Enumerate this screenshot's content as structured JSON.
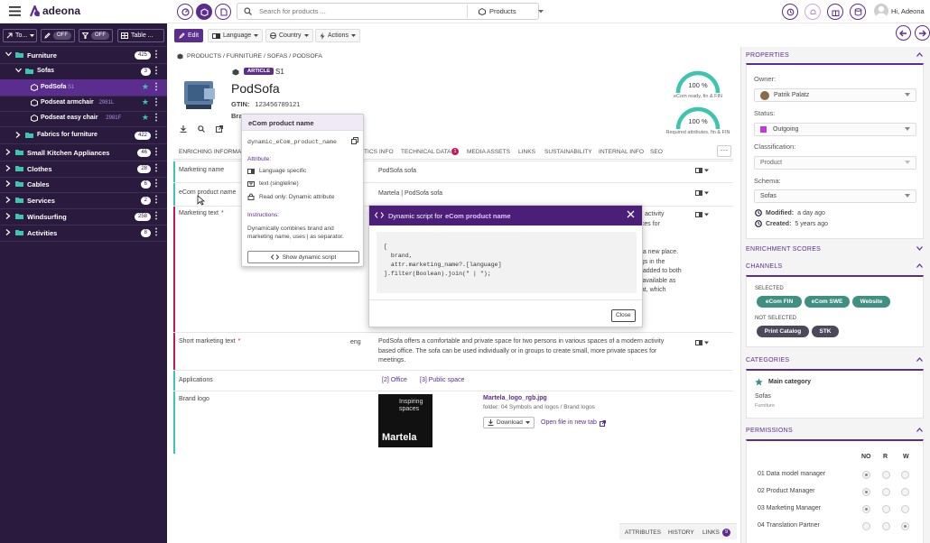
{
  "app": {
    "name": "adeona",
    "user_greeting": "Hi, Adeona"
  },
  "search": {
    "placeholder": "Search for products ...",
    "scope": "Products"
  },
  "sidebar_tools": {
    "type_label": "To...",
    "filter1": "OFF",
    "filter2": "OFF",
    "view_label": "Table ..."
  },
  "tree": [
    {
      "label": "Furniture",
      "count": "425",
      "level": 0
    },
    {
      "label": "Sofas",
      "count": "3",
      "level": 1
    },
    {
      "label": "PodSofa",
      "sku": "S1",
      "level": 2,
      "product": true,
      "selected": true
    },
    {
      "label": "Podseat armchair",
      "sku": "2981L",
      "level": 2,
      "product": true
    },
    {
      "label": "Podseat easy chair",
      "sku": "2981F",
      "level": 2,
      "product": true
    },
    {
      "label": "Fabrics for furniture",
      "count": "422",
      "level": 1
    },
    {
      "label": "Small Kitchen Appliances",
      "count": "46",
      "level": 0
    },
    {
      "label": "Clothes",
      "count": "28",
      "level": 0
    },
    {
      "label": "Cables",
      "count": "6",
      "level": 0
    },
    {
      "label": "Services",
      "count": "2",
      "level": 0
    },
    {
      "label": "Windsurfing",
      "count": "258",
      "level": 0
    },
    {
      "label": "Activities",
      "count": "8",
      "level": 0
    }
  ],
  "actions": {
    "edit": "Edit",
    "language": "Language",
    "country": "Country",
    "actions": "Actions"
  },
  "breadcrumb": "PRODUCTS / FURNITURE / SOFAS / PODSOFA",
  "product": {
    "badge": "ARTICLE",
    "sku": "S1",
    "name": "PodSofa",
    "gtin_label": "GTIN:",
    "gtin": "123456789121",
    "brand_label": "Bra"
  },
  "scores": [
    {
      "value": "100 %",
      "caption": "eCom ready, fin & FIN",
      "fraction": 1.0
    },
    {
      "value": "100 %",
      "caption": "Required attributes, fin & FIN",
      "fraction": 1.0
    }
  ],
  "tabs": [
    "ENRICHING INFORMATI",
    "TICS INFO",
    "TECHNICAL DATA",
    "MEDIA ASSETS",
    "LINKS",
    "SUSTAINABILITY",
    "INTERNAL INFO",
    "SEO"
  ],
  "tab_badge": "1",
  "rows": {
    "marketing_name": {
      "label": "Marketing name",
      "value": "PodSofa sofa"
    },
    "ecom_name": {
      "label": "eCom product name",
      "value": "Martela | PodSofa sofa"
    },
    "marketing_text": {
      "label": "Marketing text",
      "required": "*",
      "frag": [
        "rn activity",
        "aces for",
        "",
        "",
        "o a new place.",
        "ngs in the",
        "e added to both",
        "s available as",
        "eat, which"
      ]
    },
    "short_text": {
      "label": "Short marketing text",
      "required": "*",
      "lang": "eng",
      "value": "PodSofa offers a comfortable and private space for two persons in various spaces of a modern activity based office. The sofa can be used individually or in groups to create small, more private spaces for meetings."
    },
    "applications": {
      "label": "Applications",
      "tags": [
        "[2] Office",
        "[3] Public space"
      ]
    },
    "brand_logo": {
      "label": "Brand logo",
      "file": "Martela_logo_rgb.jpg",
      "folder": "folder: 04 Symbols and logos / Brand logos",
      "download": "Download",
      "open": "Open file in new tab",
      "logo_line1": "Inspiring",
      "logo_line2": "spaces",
      "logo_brand": "Martela"
    }
  },
  "tooltip": {
    "title": "eCom product name",
    "field": "dynamic_eCom_product_name",
    "attribute_label": "Attribute:",
    "attr1": "Language specific",
    "attr2": "text (singleline)",
    "attr3": "Read only: Dynamic attribute",
    "instr_label": "Instructions:",
    "instr": "Dynamically combines brand and marketing name, uses | as separator.",
    "button": "Show dynamic script"
  },
  "dynamic": {
    "title_prefix": "Dynamic script for",
    "title_field": "eCom product name",
    "code": [
      "[",
      "  brand,",
      "  attr.marketing_name?.[language]",
      "].filter(Boolean).join(\" | \");"
    ],
    "close": "Close"
  },
  "bottom_tabs": {
    "attributes": "ATTRIBUTES",
    "history": "HISTORY",
    "links": "LINKS",
    "links_count": "9"
  },
  "properties": {
    "title": "PROPERTIES",
    "owner_label": "Owner:",
    "owner": "Patrik Palatz",
    "status_label": "Status:",
    "status": "Outgoing",
    "status_color": "#c238d8",
    "class_label": "Classification:",
    "classification": "Product",
    "schema_label": "Schema:",
    "schema": "Sofas",
    "modified_label": "Modified:",
    "modified": "a day ago",
    "created_label": "Created:",
    "created": "5 years ago"
  },
  "enrichment": {
    "title": "ENRICHMENT SCORES"
  },
  "channels": {
    "title": "CHANNELS",
    "selected_label": "SELECTED",
    "selected": [
      "eCom FIN",
      "eCom SWE",
      "Website"
    ],
    "not_selected_label": "NOT SELECTED",
    "not_selected": [
      "Print Catalog",
      "STK"
    ],
    "selected_color": "#3f8f83",
    "not_selected_color": "#4a4a5a"
  },
  "categories": {
    "title": "CATEGORIES",
    "main_label": "Main category",
    "item": "Sofas",
    "item_sub": "Furniture"
  },
  "permissions": {
    "title": "PERMISSIONS",
    "columns": [
      "NO",
      "R",
      "W"
    ],
    "rows": [
      {
        "name": "01 Data model manager",
        "sel": 0
      },
      {
        "name": "02 Product Manager",
        "sel": 0
      },
      {
        "name": "03 Marketing Manager",
        "sel": 0
      },
      {
        "name": "04 Translation Partner",
        "sel": 2
      }
    ]
  },
  "colors": {
    "brand": "#5b2d8e",
    "sidebar": "#2a1a3e",
    "accent_green": "#3ec5b0"
  }
}
